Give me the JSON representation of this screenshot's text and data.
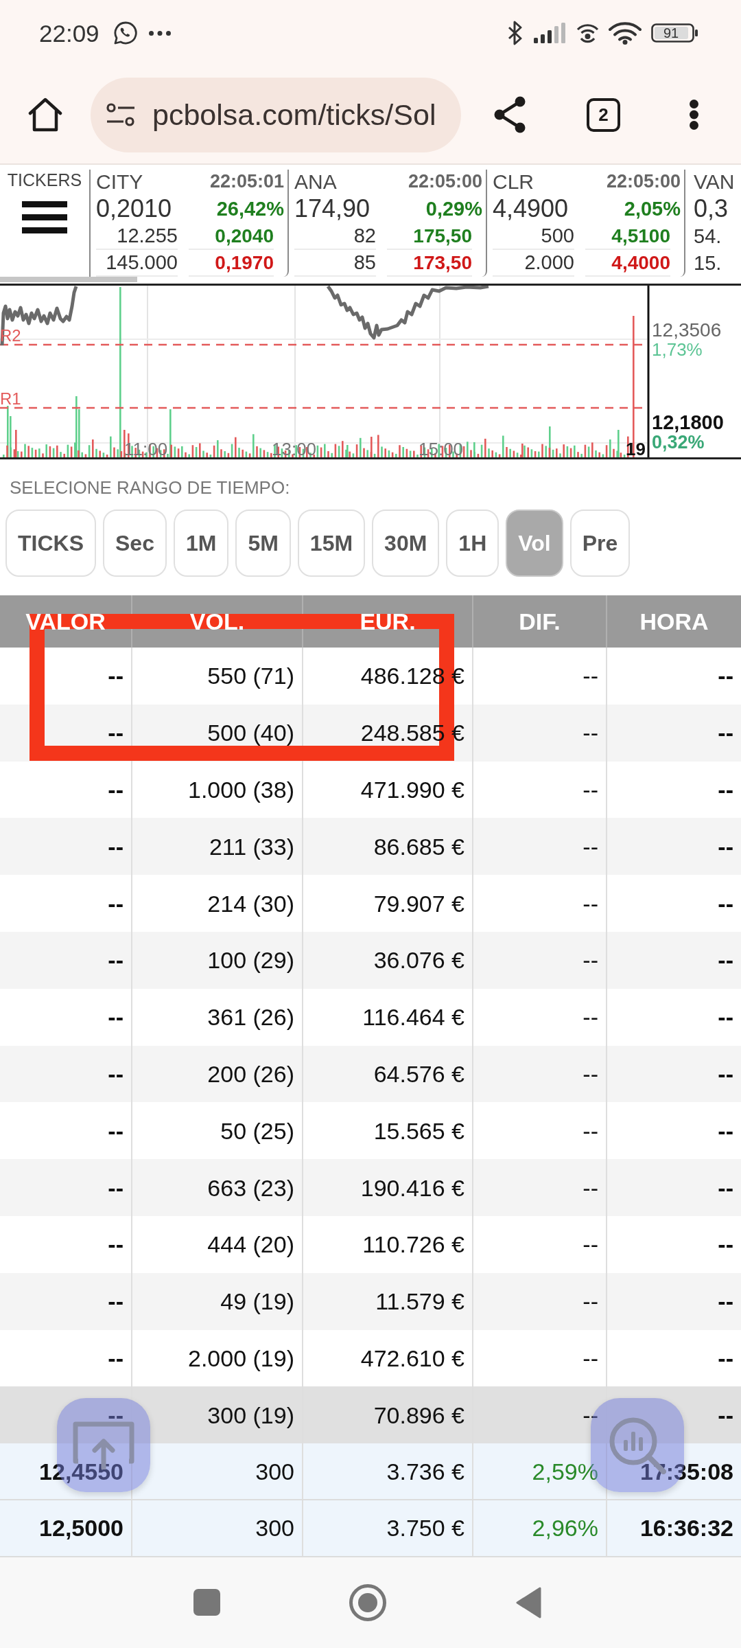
{
  "status_bar": {
    "time": "22:09",
    "battery": "91"
  },
  "browser": {
    "url": "pcbolsa.com/ticks/Sol",
    "tab_count": "2"
  },
  "tickers": {
    "label": "TICKERS",
    "items": [
      {
        "symbol": "CITY",
        "time": "22:05:01",
        "price": "0,2010",
        "change": "26,42%",
        "line_3": [
          "12.255",
          "0,2040"
        ],
        "line_4": [
          "145.000",
          "0,1970"
        ]
      },
      {
        "symbol": "ANA",
        "time": "22:05:00",
        "price": "174,90",
        "change": "0,29%",
        "line_3": [
          "82",
          "175,50"
        ],
        "line_4": [
          "85",
          "173,50"
        ]
      },
      {
        "symbol": "CLR",
        "time": "22:05:00",
        "price": "4,4900",
        "change": "2,05%",
        "line_3": [
          "500",
          "4,5100"
        ],
        "line_4": [
          "2.000",
          "4,4000"
        ]
      },
      {
        "symbol": "VAN",
        "price": "0,3",
        "line_3": [
          "54."
        ],
        "line_4": [
          "15."
        ]
      }
    ]
  },
  "chart": {
    "levels": [
      "R2",
      "R1"
    ],
    "upper_price": "12,3506",
    "upper_change": "1,73%",
    "last_price": "12,1800",
    "last_change": "0,32%",
    "time_labels": [
      "11:00",
      "13:00",
      "15:00"
    ],
    "end_label": "19"
  },
  "time_range": {
    "title": "SELECIONE RANGO DE TIEMPO:",
    "options": [
      {
        "label": "TICKS",
        "selected": false
      },
      {
        "label": "Sec",
        "selected": false
      },
      {
        "label": "1M",
        "selected": false
      },
      {
        "label": "5M",
        "selected": false
      },
      {
        "label": "15M",
        "selected": false
      },
      {
        "label": "30M",
        "selected": false
      },
      {
        "label": "1H",
        "selected": false
      },
      {
        "label": "Vol",
        "selected": true
      },
      {
        "label": "Pre",
        "selected": false
      }
    ]
  },
  "table": {
    "columns": [
      "VALOR",
      "VOL.",
      "EUR.",
      "DIF.",
      "HORA"
    ],
    "rows": [
      {
        "kind": "level",
        "selected": false,
        "cells": [
          "--",
          "550 (71)",
          "486.128 €",
          "--",
          "--"
        ]
      },
      {
        "kind": "level",
        "selected": false,
        "cells": [
          "--",
          "500 (40)",
          "248.585 €",
          "--",
          "--"
        ]
      },
      {
        "kind": "level",
        "selected": false,
        "cells": [
          "--",
          "1.000 (38)",
          "471.990 €",
          "--",
          "--"
        ]
      },
      {
        "kind": "level",
        "selected": false,
        "cells": [
          "--",
          "211 (33)",
          "86.685 €",
          "--",
          "--"
        ]
      },
      {
        "kind": "level",
        "selected": false,
        "cells": [
          "--",
          "214 (30)",
          "79.907 €",
          "--",
          "--"
        ]
      },
      {
        "kind": "level",
        "selected": false,
        "cells": [
          "--",
          "100 (29)",
          "36.076 €",
          "--",
          "--"
        ]
      },
      {
        "kind": "level",
        "selected": false,
        "cells": [
          "--",
          "361 (26)",
          "116.464 €",
          "--",
          "--"
        ]
      },
      {
        "kind": "level",
        "selected": false,
        "cells": [
          "--",
          "200 (26)",
          "64.576 €",
          "--",
          "--"
        ]
      },
      {
        "kind": "level",
        "selected": false,
        "cells": [
          "--",
          "50 (25)",
          "15.565 €",
          "--",
          "--"
        ]
      },
      {
        "kind": "level",
        "selected": false,
        "cells": [
          "--",
          "663 (23)",
          "190.416 €",
          "--",
          "--"
        ]
      },
      {
        "kind": "level",
        "selected": false,
        "cells": [
          "--",
          "444 (20)",
          "110.726 €",
          "--",
          "--"
        ]
      },
      {
        "kind": "level",
        "selected": false,
        "cells": [
          "--",
          "49 (19)",
          "11.579 €",
          "--",
          "--"
        ]
      },
      {
        "kind": "level",
        "selected": false,
        "cells": [
          "--",
          "2.000 (19)",
          "472.610 €",
          "--",
          "--"
        ]
      },
      {
        "kind": "level",
        "selected": true,
        "cells": [
          "--",
          "300 (19)",
          "70.896 €",
          "--",
          "--"
        ]
      },
      {
        "kind": "trade",
        "selected": false,
        "cells": [
          "12,4550",
          "300",
          "3.736 €",
          "2,59%",
          "17:35:08"
        ]
      },
      {
        "kind": "trade",
        "selected": false,
        "cells": [
          "12,5000",
          "300",
          "3.750 €",
          "2,96%",
          "16:36:32"
        ]
      }
    ]
  }
}
